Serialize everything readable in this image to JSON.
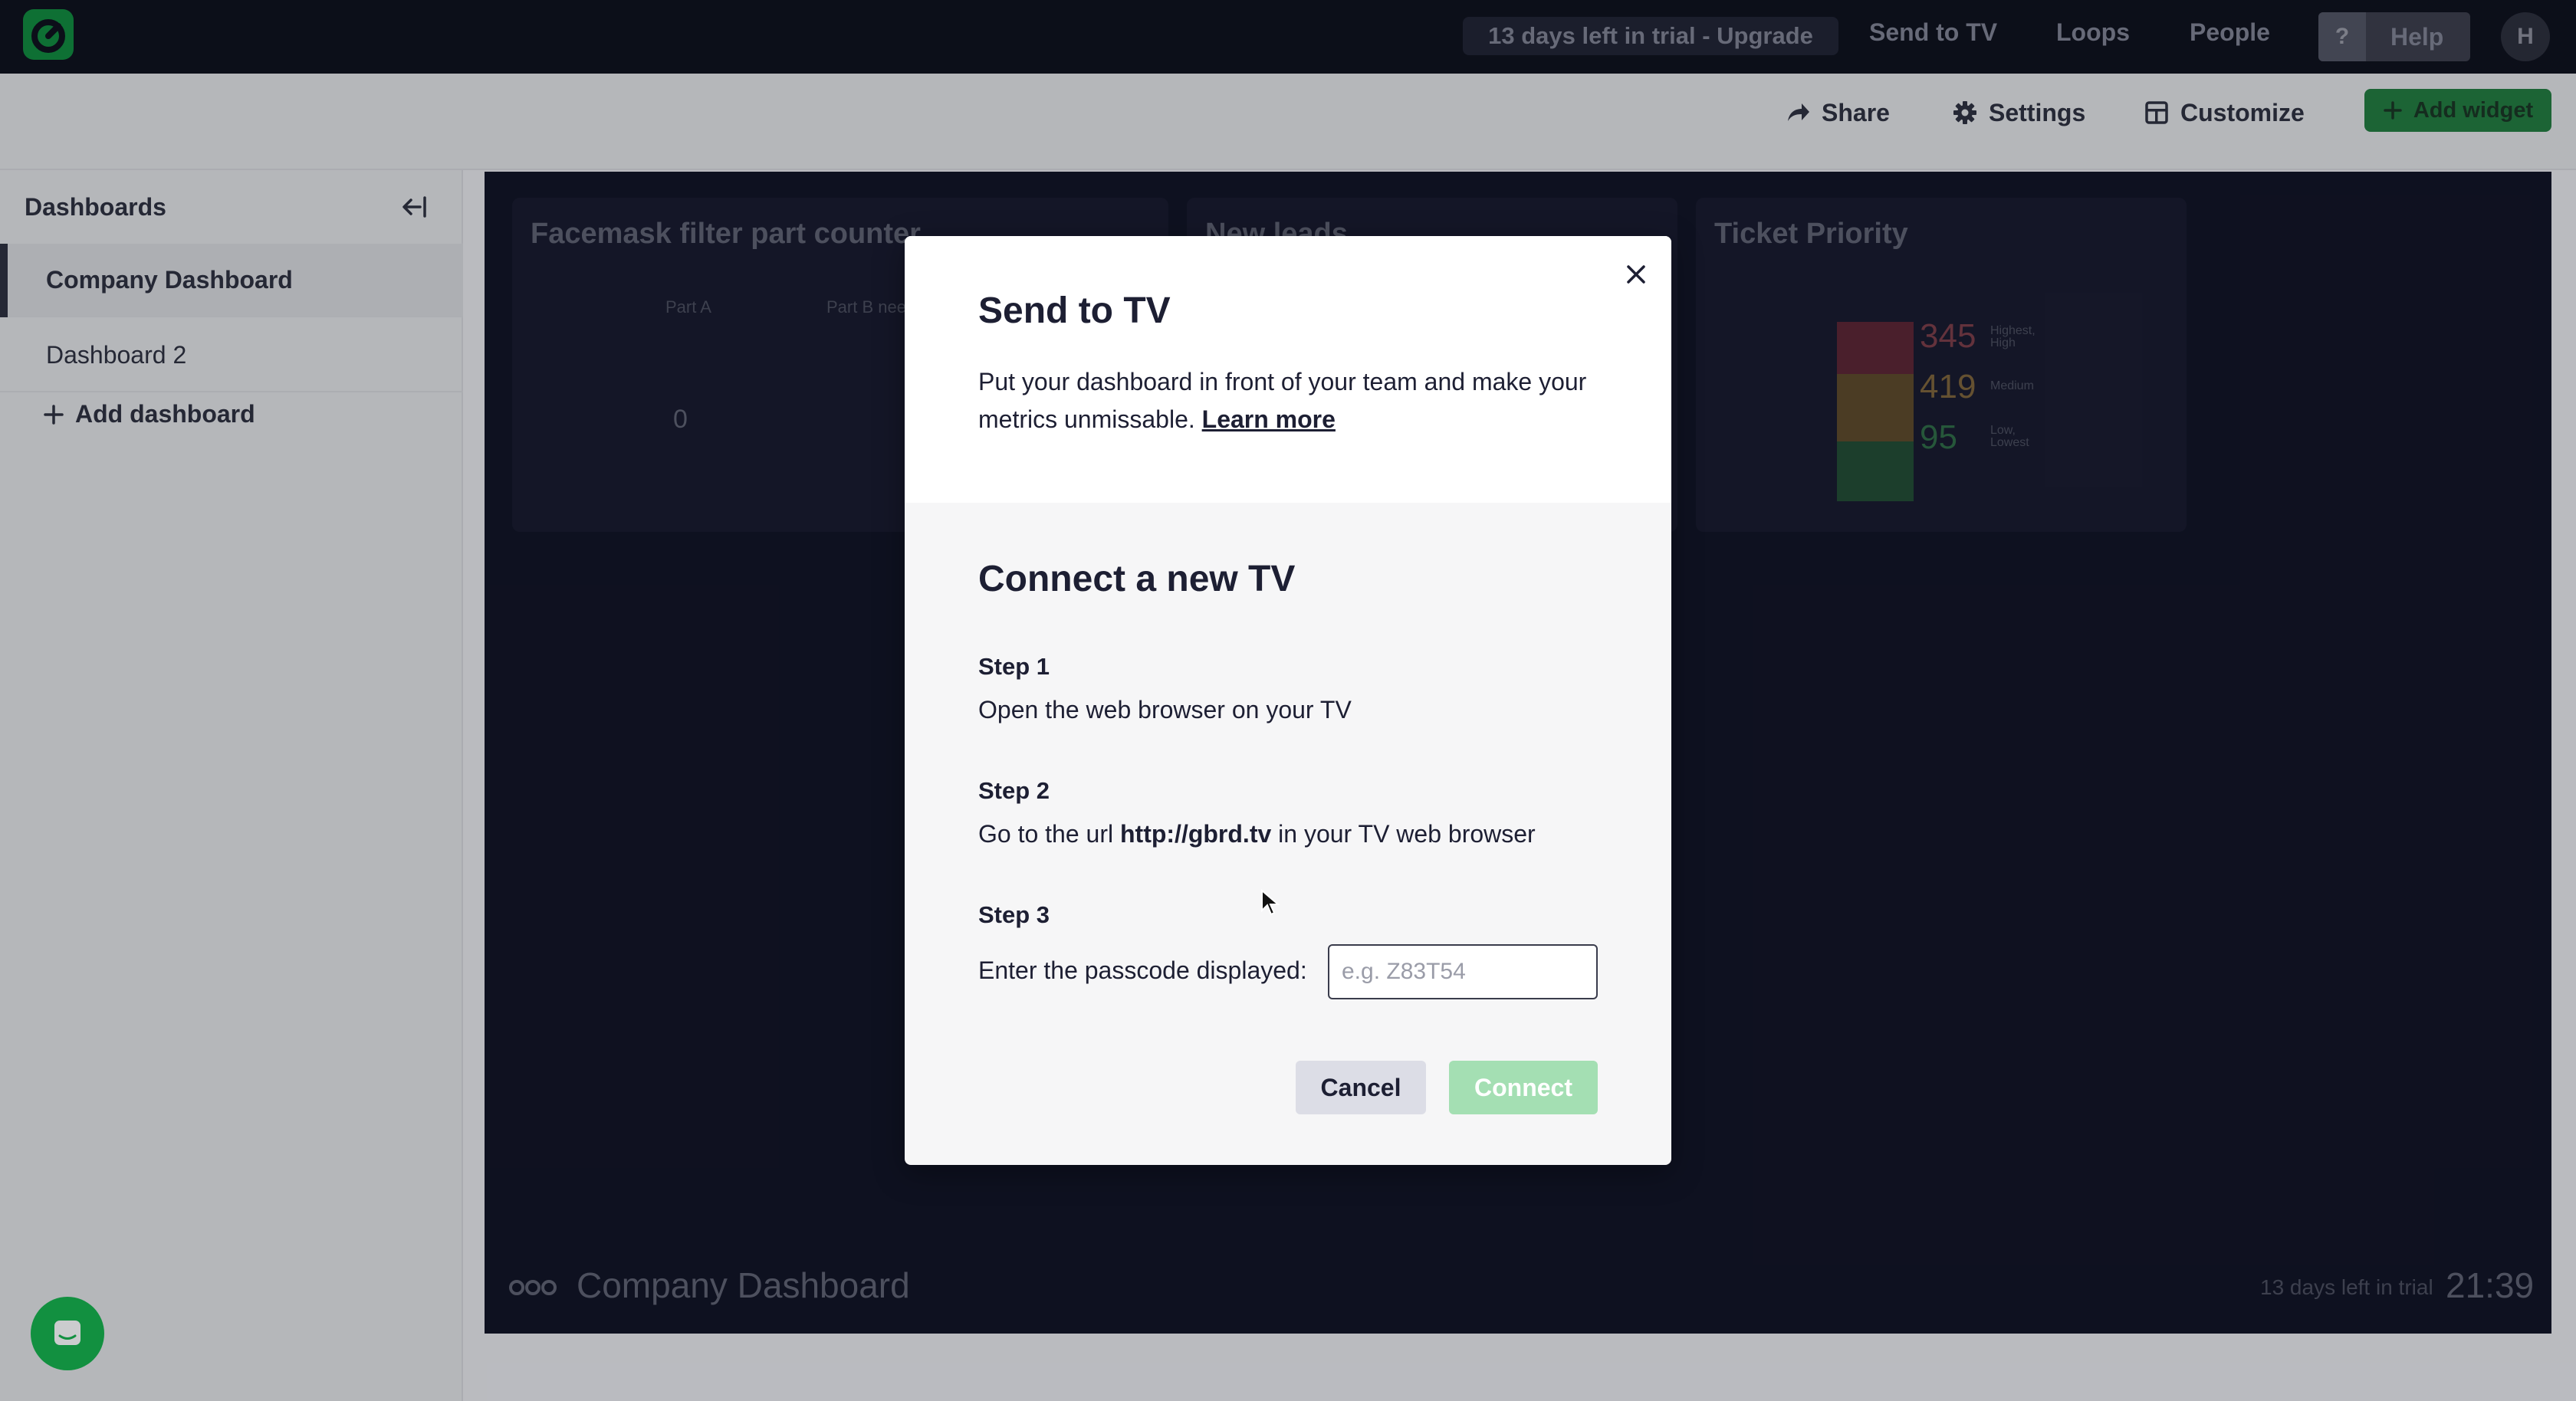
{
  "topbar": {
    "trial": "13 days left in trial - Upgrade",
    "nav": [
      "Send to TV",
      "Loops",
      "People"
    ],
    "help_q": "?",
    "help": "Help",
    "avatar": "H"
  },
  "toolbar": {
    "share": "Share",
    "settings": "Settings",
    "customize": "Customize",
    "add_widget": "Add widget"
  },
  "sidebar": {
    "title": "Dashboards",
    "items": [
      {
        "label": "Company Dashboard",
        "active": true
      },
      {
        "label": "Dashboard 2",
        "active": false
      }
    ],
    "add": "Add dashboard"
  },
  "dashboard": {
    "widgets": [
      {
        "title": "Facemask filter part counter",
        "col_a": "Part A",
        "col_b": "Part B needed",
        "value": "0"
      },
      {
        "title": "New leads"
      },
      {
        "title": "Ticket Priority",
        "rows": [
          {
            "value": "345",
            "label": "Highest, High",
            "color": "#d03c3c"
          },
          {
            "value": "419",
            "label": "Medium",
            "color": "#e6a12a"
          },
          {
            "value": "95",
            "label": "Low, Lowest",
            "color": "#27a846"
          }
        ]
      }
    ],
    "footer_title": "Company Dashboard",
    "footer_trial": "13 days left in trial",
    "clock": "21:39"
  },
  "modal": {
    "title": "Send to TV",
    "description": "Put your dashboard in front of your team and make your metrics unmissable.",
    "learn_more": "Learn more",
    "section_title": "Connect a new TV",
    "steps": [
      {
        "label": "Step 1",
        "text": "Open the web browser on your TV"
      },
      {
        "label": "Step 2",
        "text_before": "Go to the url",
        "url": "http://gbrd.tv",
        "text_after": "in your TV web browser"
      },
      {
        "label": "Step 3",
        "text": "Enter the passcode displayed:"
      }
    ],
    "passcode_placeholder": "e.g. Z83T54",
    "cancel": "Cancel",
    "connect": "Connect"
  },
  "colors": {
    "brand_green": "#13b34a",
    "connect_disabled": "#a4dfb3",
    "topbar_bg": "#0b0d18"
  }
}
